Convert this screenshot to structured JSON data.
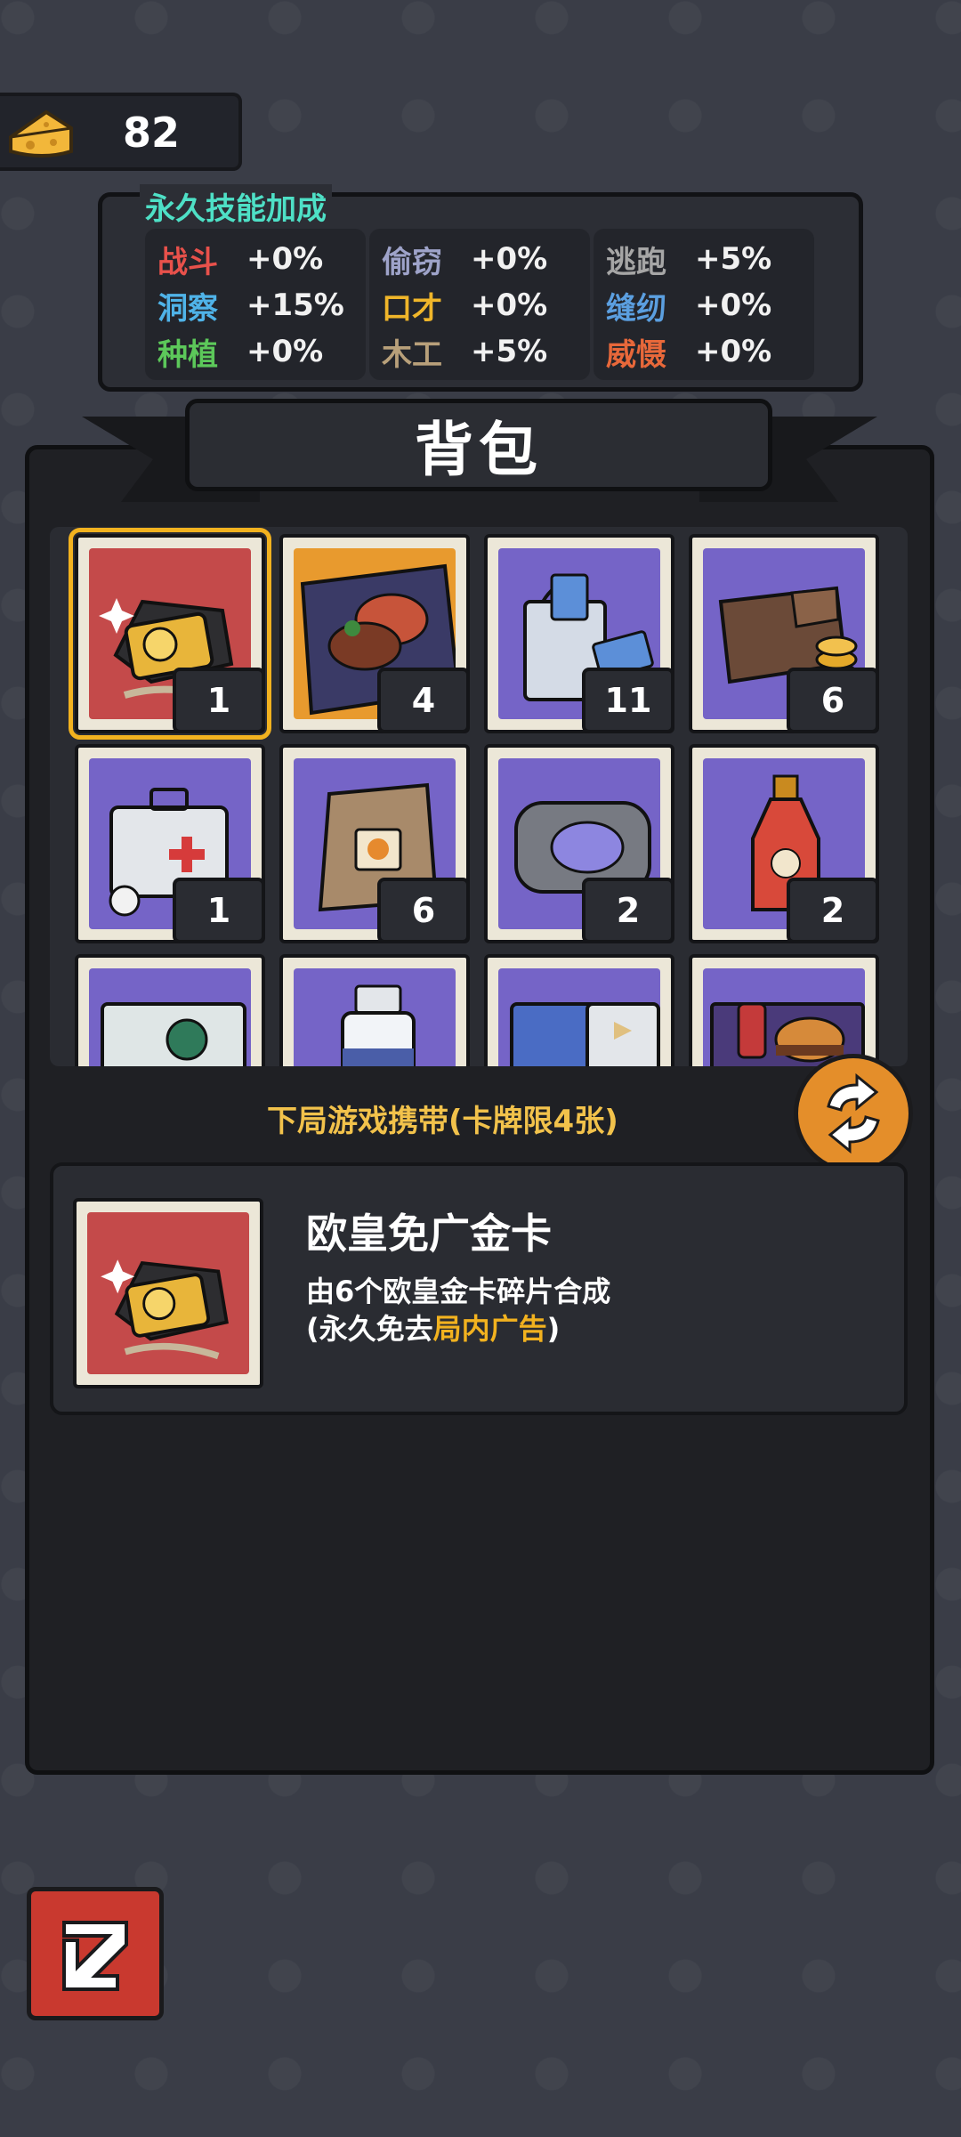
{
  "currency": {
    "value": "82",
    "icon": "cheese-icon"
  },
  "skills": {
    "title": "永久技能加成",
    "columns": [
      [
        {
          "name": "战斗",
          "value": "+0%",
          "color": "#e8514b"
        },
        {
          "name": "洞察",
          "value": "+15%",
          "color": "#4fb3e8"
        },
        {
          "name": "种植",
          "value": "+0%",
          "color": "#5cc85a"
        }
      ],
      [
        {
          "name": "偷窃",
          "value": "+0%",
          "color": "#9ea3c9"
        },
        {
          "name": "口才",
          "value": "+0%",
          "color": "#f0b62a"
        },
        {
          "name": "木工",
          "value": "+5%",
          "color": "#b8a07a"
        }
      ],
      [
        {
          "name": "逃跑",
          "value": "+5%",
          "color": "#a6a6a6"
        },
        {
          "name": "缝纫",
          "value": "+0%",
          "color": "#5b9fe0"
        },
        {
          "name": "威慑",
          "value": "+0%",
          "color": "#e8683a"
        }
      ]
    ]
  },
  "backpack": {
    "title": "背包",
    "items": [
      {
        "icon": "gold-card-icon",
        "count": "1",
        "bg": "#c44a4a",
        "selected": true
      },
      {
        "icon": "steak-pasta-icon",
        "count": "4",
        "bg": "#e89a2e"
      },
      {
        "icon": "shopping-bag-icon",
        "count": "11",
        "bg": "#7564c7"
      },
      {
        "icon": "wallet-coins-icon",
        "count": "6",
        "bg": "#7564c7"
      },
      {
        "icon": "first-aid-kit-icon",
        "count": "1",
        "bg": "#7564c7"
      },
      {
        "icon": "paper-bag-icon",
        "count": "6",
        "bg": "#7564c7"
      },
      {
        "icon": "pouch-icon",
        "count": "2",
        "bg": "#7564c7"
      },
      {
        "icon": "ketchup-bottle-icon",
        "count": "2",
        "bg": "#7564c7"
      },
      {
        "icon": "virus-box-icon",
        "count": "",
        "bg": "#7564c7"
      },
      {
        "icon": "medicine-bottle-icon",
        "count": "",
        "bg": "#7564c7"
      },
      {
        "icon": "pills-icon",
        "count": "",
        "bg": "#7564c7"
      },
      {
        "icon": "burger-meal-icon",
        "count": "",
        "bg": "#7564c7"
      }
    ]
  },
  "carry_label": "下局游戏携带(卡牌限4张)",
  "detail": {
    "name": "欧皇免广金卡",
    "desc_line1": "由6个欧皇金卡碎片合成",
    "desc_line2_prefix": "(永久免去",
    "desc_line2_highlight": "局内广告",
    "desc_line2_suffix": ")"
  }
}
